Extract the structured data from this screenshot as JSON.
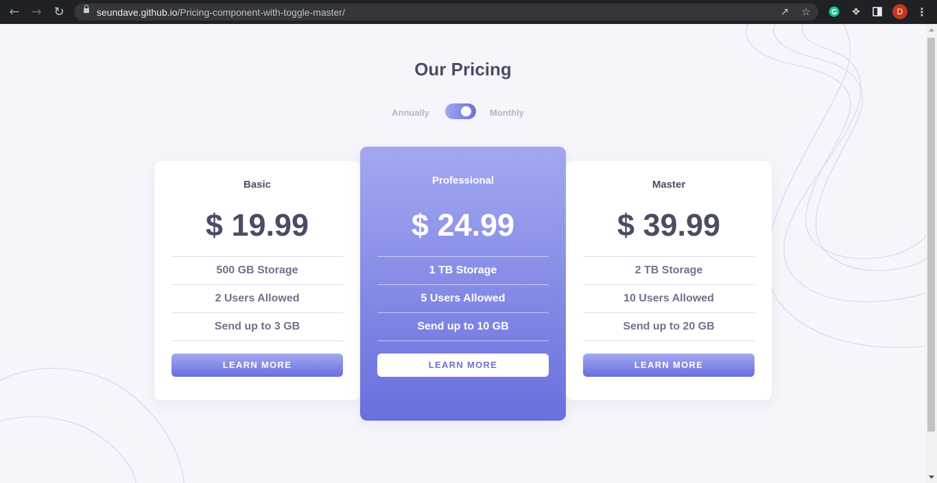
{
  "browser": {
    "back_icon": "arrow-left",
    "forward_icon": "arrow-right",
    "reload_icon": "reload",
    "url_host": "seundave.github.io",
    "url_path": "/Pricing-component-with-toggle-master/",
    "avatar_letter": "D"
  },
  "page": {
    "title": "Our Pricing",
    "toggle": {
      "left_label": "Annually",
      "right_label": "Monthly",
      "state": "monthly"
    },
    "plans": [
      {
        "name": "Basic",
        "price": "$ 19.99",
        "features": [
          "500 GB Storage",
          "2 Users Allowed",
          "Send up to 3 GB"
        ],
        "button": "LEARN MORE"
      },
      {
        "name": "Professional",
        "price": "$ 24.99",
        "features": [
          "1 TB Storage",
          "5 Users Allowed",
          "Send up to 10 GB"
        ],
        "button": "LEARN MORE",
        "featured": true
      },
      {
        "name": "Master",
        "price": "$ 39.99",
        "features": [
          "2 TB Storage",
          "10 Users Allowed",
          "Send up to 20 GB"
        ],
        "button": "LEARN MORE"
      }
    ],
    "accent_gradient": [
      "#a3a8f0",
      "#696fdd"
    ],
    "text_color": "#4a4d63"
  }
}
